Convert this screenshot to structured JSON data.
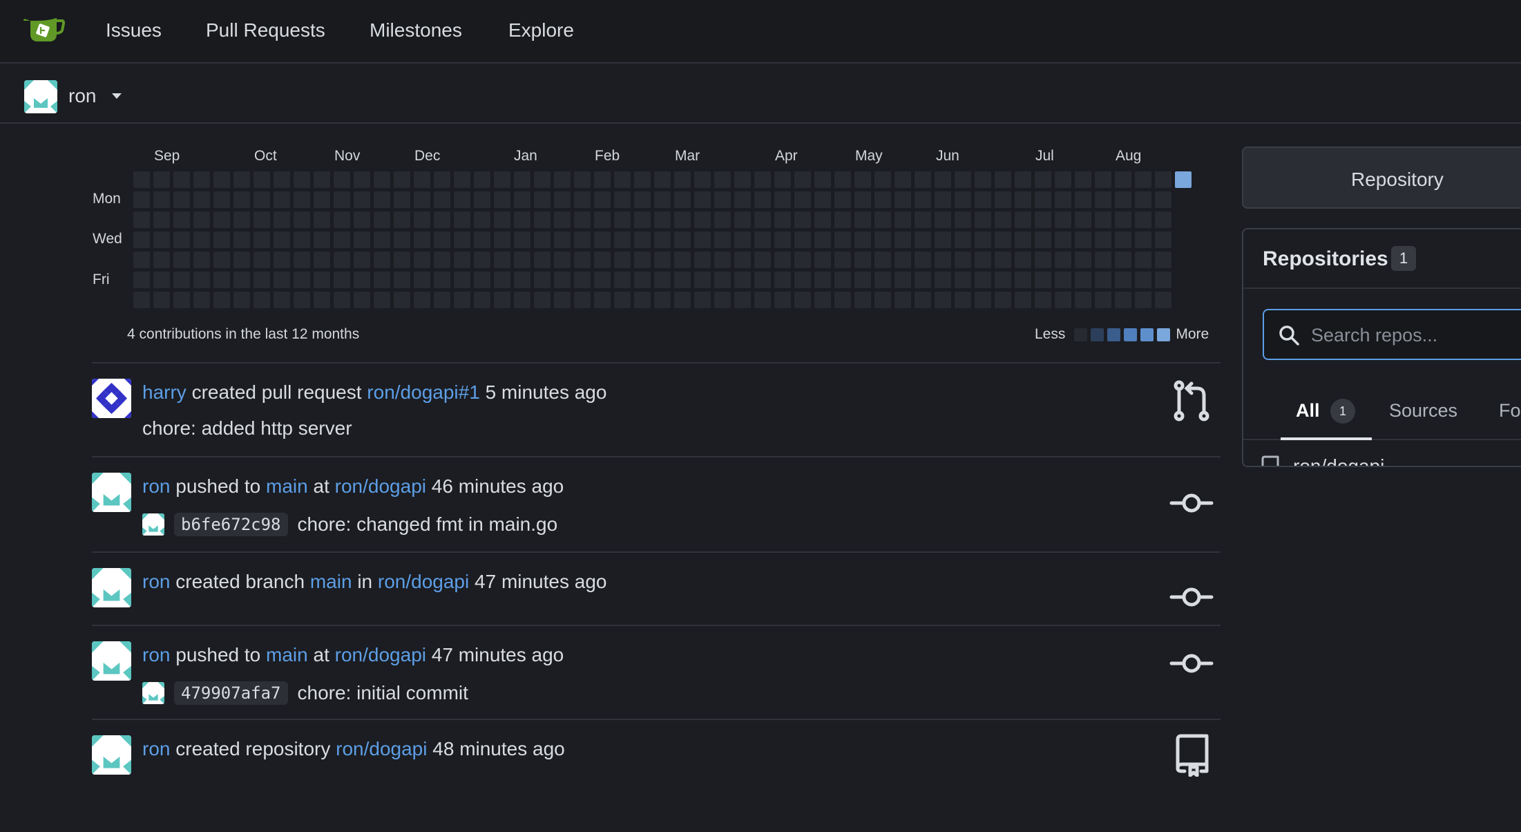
{
  "nav": {
    "items": [
      "Issues",
      "Pull Requests",
      "Milestones",
      "Explore"
    ]
  },
  "context": {
    "user": "ron"
  },
  "heatmap": {
    "months": [
      "Sep",
      "Oct",
      "Nov",
      "Dec",
      "Jan",
      "Feb",
      "Mar",
      "Apr",
      "May",
      "Jun",
      "Jul",
      "Aug"
    ],
    "day_labels": [
      "Mon",
      "Wed",
      "Fri"
    ],
    "summary": "4 contributions in the last 12 months",
    "legend_less": "Less",
    "legend_more": "More",
    "colors": {
      "empty": "#272a30",
      "l1": "#2c3f5a",
      "l2": "#3a5d8c",
      "l3": "#4f7fbd",
      "l4": "#7aa7dc"
    }
  },
  "feed": [
    {
      "actor": "harry",
      "action": "created pull request",
      "target": "ron/dogapi#1",
      "time": "5 minutes ago",
      "desc": "chore: added http server",
      "icon": "git-pull-request-icon"
    },
    {
      "actor": "ron",
      "action": "pushed to",
      "branch": "main",
      "joiner": "at",
      "repo": "ron/dogapi",
      "time": "46 minutes ago",
      "sha": "b6fe672c98",
      "commit_msg": "chore: changed fmt in main.go",
      "icon": "git-commit-icon"
    },
    {
      "actor": "ron",
      "action": "created branch",
      "branch": "main",
      "joiner": "in",
      "repo": "ron/dogapi",
      "time": "47 minutes ago",
      "icon": "git-commit-icon"
    },
    {
      "actor": "ron",
      "action": "pushed to",
      "branch": "main",
      "joiner": "at",
      "repo": "ron/dogapi",
      "time": "47 minutes ago",
      "sha": "479907afa7",
      "commit_msg": "chore: initial commit",
      "icon": "git-commit-icon"
    },
    {
      "actor": "ron",
      "action": "created repository",
      "repo": "ron/dogapi",
      "time": "48 minutes ago",
      "icon": "repo-icon"
    }
  ],
  "sidebar": {
    "repo_button": "Repository",
    "repos_title": "Repositories",
    "repos_count": "1",
    "search_placeholder": "Search repos...",
    "tabs": {
      "all": "All",
      "all_count": "1",
      "sources": "Sources",
      "forks": "Fo"
    },
    "repos": [
      "ron/dogapi"
    ]
  }
}
